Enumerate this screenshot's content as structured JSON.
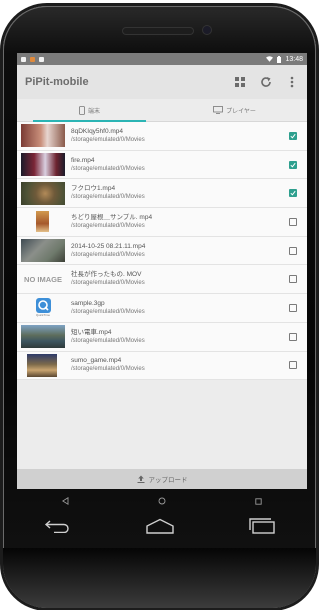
{
  "status_bar": {
    "time": "13:48"
  },
  "app": {
    "title": "PiPit-mobile"
  },
  "tabs": [
    {
      "label": "端末",
      "active": true
    },
    {
      "label": "プレイヤー",
      "active": false
    }
  ],
  "files": [
    {
      "name": "8qDKIqy5hf0.mp4",
      "path": "/storage/emulated/0/Movies",
      "checked": true
    },
    {
      "name": "fire.mp4",
      "path": "/storage/emulated/0/Movies",
      "checked": true
    },
    {
      "name": "フクロウ1.mp4",
      "path": "/storage/emulated/0/Movies",
      "checked": true
    },
    {
      "name": "ちどり屋根＿サンプル. mp4",
      "path": "/storage/emulated/0/Movies",
      "checked": false
    },
    {
      "name": "2014-10-25 08.21.11.mp4",
      "path": "/storage/emulated/0/Movies",
      "checked": false
    },
    {
      "name": "社長が作ったもの. MOV",
      "path": "/storage/emulated/0/Movies",
      "checked": false
    },
    {
      "name": "sample.3gp",
      "path": "/storage/emulated/0/Movies",
      "checked": false
    },
    {
      "name": "短い電車.mp4",
      "path": "/storage/emulated/0/Movies",
      "checked": false
    },
    {
      "name": "sumo_game.mp4",
      "path": "/storage/emulated/0/Movies",
      "checked": false
    }
  ],
  "thumbnails": {
    "no_image_label": "NO IMAGE",
    "quicktime_caption": "QuickTime"
  },
  "upload": {
    "label": "アップロード"
  },
  "colors": {
    "accent": "#2bb4b4",
    "checked": "#2e9f8e"
  }
}
